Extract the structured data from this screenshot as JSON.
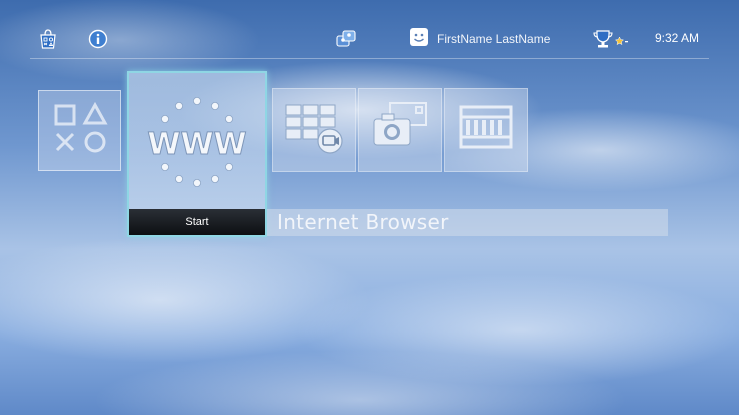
{
  "topbar": {
    "icons": {
      "store": "ps-store-icon",
      "info": "info-icon",
      "friends": "friends-icon",
      "trophy": "trophy-icon"
    },
    "profile_name": "FirstName LastName",
    "time": "9:32 AM"
  },
  "tiles": {
    "selected_action_label": "Start",
    "selected_title": "Internet Browser"
  },
  "colors": {
    "focus_border": "#8fd6e4",
    "start_bar": "#111418"
  }
}
